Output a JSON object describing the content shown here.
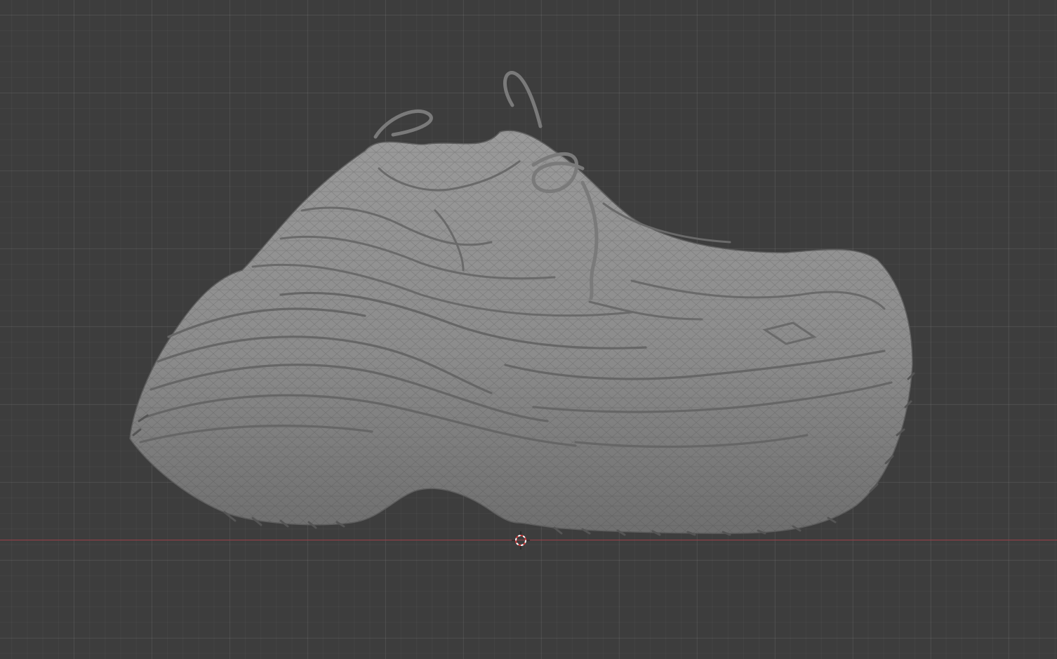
{
  "viewport": {
    "background_color": "#3d3d3d",
    "grid_color": "#4a4a4a",
    "x_axis_color": "#9a3f48"
  },
  "object": {
    "icon": "shoe-mesh-icon",
    "shade_color": "#8e8e8e"
  },
  "cursor": {
    "icon": "3d-cursor-icon",
    "ring_color_a": "#d23a3a",
    "ring_color_b": "#ffffff"
  }
}
